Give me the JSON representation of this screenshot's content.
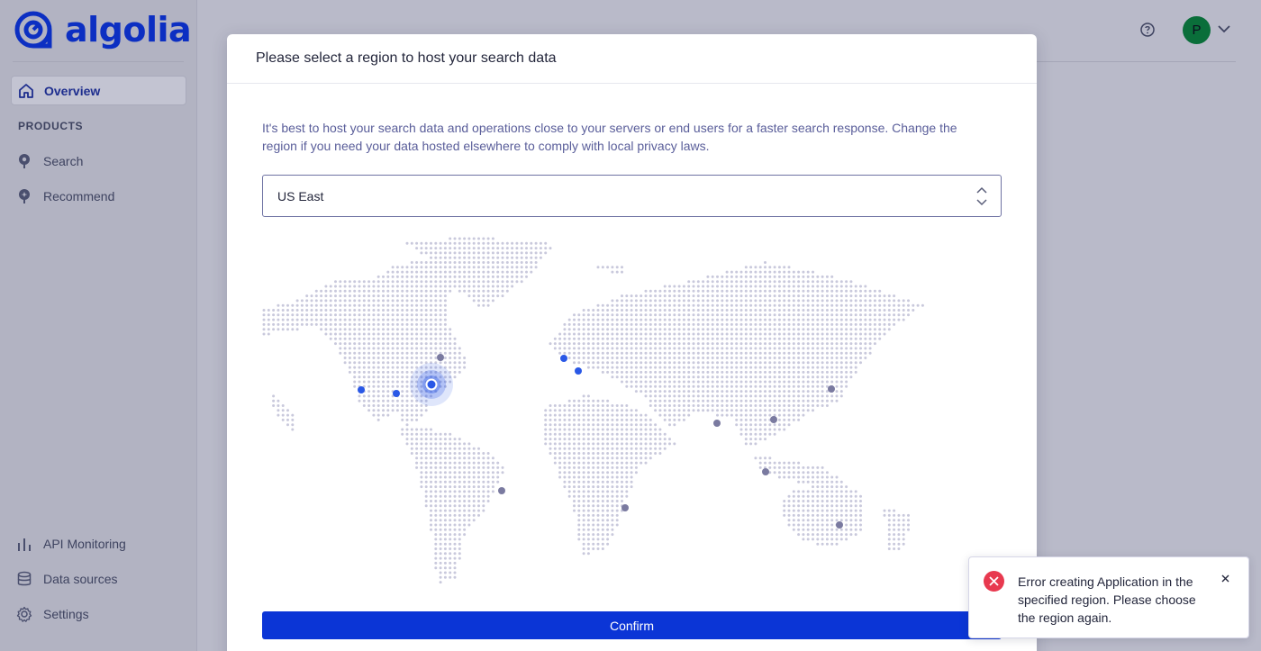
{
  "app": {
    "brand": "algolia"
  },
  "sidebar": {
    "active_item": "Overview",
    "section_title": "PRODUCTS",
    "products": [
      {
        "label": "Search",
        "icon": "search-product-icon"
      },
      {
        "label": "Recommend",
        "icon": "recommend-icon"
      }
    ],
    "bottom": [
      {
        "label": "API Monitoring",
        "icon": "bar-chart-icon"
      },
      {
        "label": "Data sources",
        "icon": "database-icon"
      },
      {
        "label": "Settings",
        "icon": "gear-icon"
      }
    ]
  },
  "header": {
    "avatar_initial": "P"
  },
  "modal": {
    "title": "Please select a region to host your search data",
    "description": "It's best to host your search data and operations close to your servers or end users for a faster search response. Change the region if you need your data hosted elsewhere to comply with local privacy laws.",
    "select_value": "US East",
    "confirm_label": "Confirm"
  },
  "toast": {
    "message": "Error creating Application in the specified region. Please choose the region again."
  },
  "colors": {
    "brand": "#0c2fc2",
    "primary_button": "#0b35d6",
    "error": "#e8394f",
    "map_dot": "#c9c9dc",
    "region_available": "#2a58e6",
    "region_unavailable": "#7a7aa0"
  }
}
